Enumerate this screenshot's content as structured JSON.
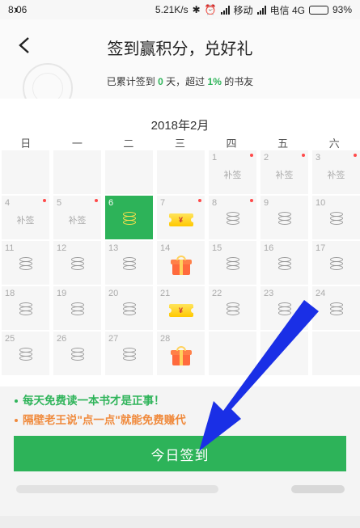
{
  "status_bar": {
    "time": "8:06",
    "speed": "5.21K/s",
    "carrier1": "移动",
    "carrier2": "电信 4G",
    "battery": "93%",
    "battery_level": 0.93
  },
  "header": {
    "title": "签到赢积分，兑好礼",
    "stats_prefix": "已累计签到",
    "days": "0",
    "stats_middle": "天，超过",
    "percent": "1%",
    "stats_suffix": "的书友"
  },
  "calendar": {
    "month_label": "2018年2月",
    "weekdays": [
      "日",
      "一",
      "二",
      "三",
      "四",
      "五",
      "六"
    ],
    "makeup_label": "补签",
    "ticket_text": "¥",
    "days": [
      {
        "num": "1",
        "type": "makeup",
        "dot": true
      },
      {
        "num": "2",
        "type": "makeup",
        "dot": true
      },
      {
        "num": "3",
        "type": "makeup",
        "dot": true
      },
      {
        "num": "4",
        "type": "makeup",
        "dot": true
      },
      {
        "num": "5",
        "type": "makeup",
        "dot": true
      },
      {
        "num": "6",
        "type": "today",
        "dot": false
      },
      {
        "num": "7",
        "type": "ticket",
        "dot": true
      },
      {
        "num": "8",
        "type": "coins",
        "dot": true
      },
      {
        "num": "9",
        "type": "coins",
        "dot": false
      },
      {
        "num": "10",
        "type": "coins",
        "dot": false
      },
      {
        "num": "11",
        "type": "coins",
        "dot": false
      },
      {
        "num": "12",
        "type": "coins",
        "dot": false
      },
      {
        "num": "13",
        "type": "coins",
        "dot": false
      },
      {
        "num": "14",
        "type": "gift",
        "dot": false
      },
      {
        "num": "15",
        "type": "coins",
        "dot": false
      },
      {
        "num": "16",
        "type": "coins",
        "dot": false
      },
      {
        "num": "17",
        "type": "coins",
        "dot": false
      },
      {
        "num": "18",
        "type": "coins",
        "dot": false
      },
      {
        "num": "19",
        "type": "coins",
        "dot": false
      },
      {
        "num": "20",
        "type": "coins",
        "dot": false
      },
      {
        "num": "21",
        "type": "ticket",
        "dot": false
      },
      {
        "num": "22",
        "type": "coins",
        "dot": false
      },
      {
        "num": "23",
        "type": "coins",
        "dot": false
      },
      {
        "num": "24",
        "type": "coins",
        "dot": false
      },
      {
        "num": "25",
        "type": "coins",
        "dot": false
      },
      {
        "num": "26",
        "type": "coins",
        "dot": false
      },
      {
        "num": "27",
        "type": "coins",
        "dot": false
      },
      {
        "num": "28",
        "type": "gift",
        "dot": false
      }
    ]
  },
  "tips": {
    "tip1": "每天免费读一本书才是正事！",
    "tip2": "隔壁老王说\"点一点\"就能免费赚代"
  },
  "checkin_button": "今日签到",
  "colors": {
    "accent": "#2db359",
    "dot": "#ff4a4a",
    "orange": "#f08a3c",
    "arrow": "#1a2fe6"
  }
}
